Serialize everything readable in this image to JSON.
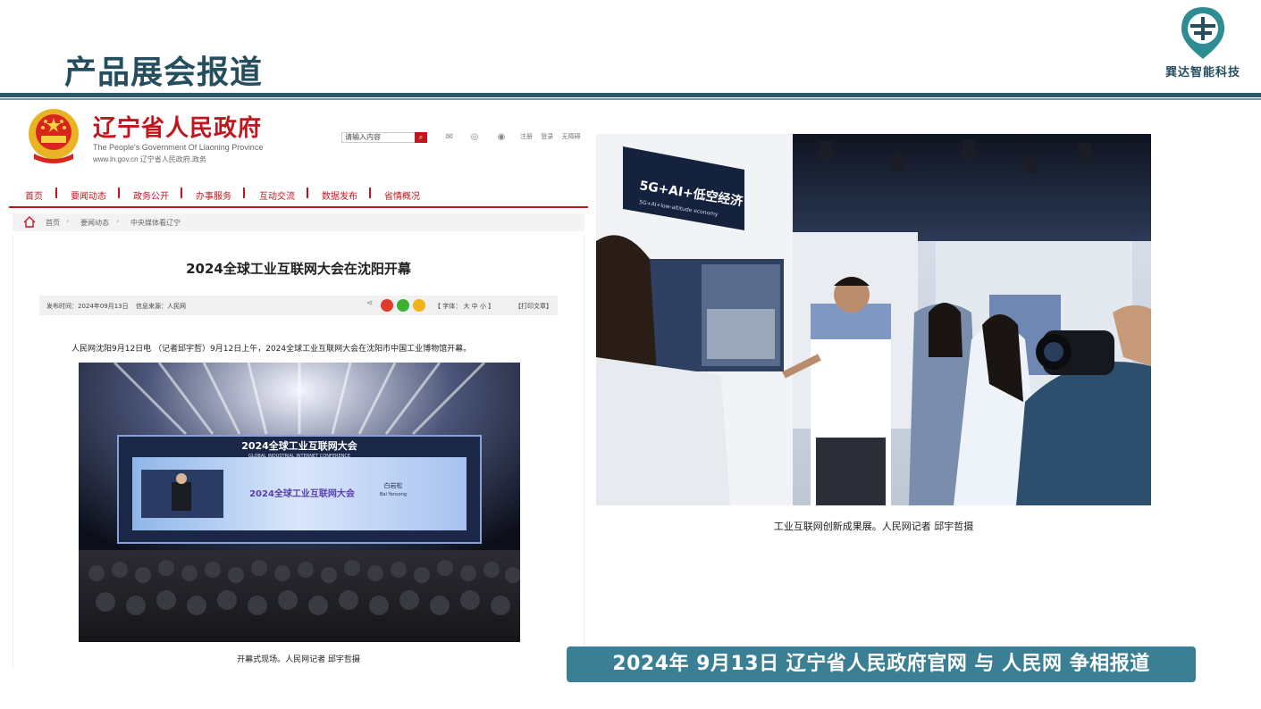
{
  "slide": {
    "title": "产品展会报道",
    "logo_text": "巽达智能科技",
    "banner": "2024年 9月13日  辽宁省人民政府官网 与 人民网 争相报道"
  },
  "gov_site": {
    "name": "辽宁省人民政府",
    "name_en": "The People's Government Of Liaoning Province",
    "url_line": "www.ln.gov.cn   辽宁省人民政府.政务",
    "search_placeholder": "请输入内容",
    "header_links": [
      "注册",
      "登录",
      "无障碍"
    ],
    "nav": [
      "首页",
      "要闻动态",
      "政务公开",
      "办事服务",
      "互动交流",
      "数据发布",
      "省情概况"
    ],
    "breadcrumb": [
      "首页",
      "要闻动态",
      "中央媒体看辽宁"
    ],
    "article": {
      "title": "2024全球工业互联网大会在沈阳开幕",
      "publish_time": "发布时间：2024年09月13日",
      "source": "信息来源：人民网",
      "font_size": "【 字体：  大  中  小 】",
      "print": "【打印文章】",
      "lead": "人民网沈阳9月12日电 （记者邱宇哲）9月12日上午，2024全球工业互联网大会在沈阳市中国工业博物馆开幕。",
      "photo_caption": "开幕式现场。人民网记者  邱宇哲摄",
      "stage_title": "2024全球工业互联网大会",
      "stage_subtitle": "GLOBAL INDUSTRIAL INTERNET CONFERENCE",
      "screen_title": "2024全球工业互联网大会",
      "speaker_name": "白岩松",
      "speaker_pinyin": "Bai Yansong"
    }
  },
  "right_photo": {
    "caption": "工业互联网创新成果展。人民网记者  邱宇哲摄",
    "sign_main": "5G+AI+低空经济",
    "sign_sub": "5G+AI+low-altitude economy"
  },
  "colors": {
    "title": "#244e5e",
    "rule": "#2c5566",
    "banner": "#3a7f93",
    "gov_red": "#c2161f"
  }
}
